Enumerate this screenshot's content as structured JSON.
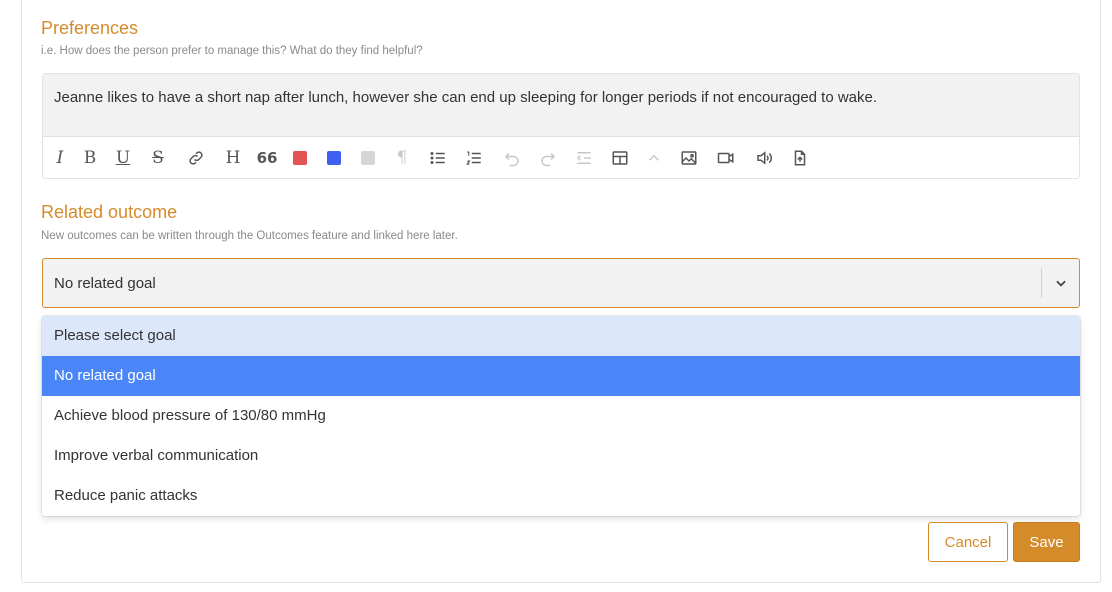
{
  "preferences": {
    "title": "Preferences",
    "hint": "i.e. How does the person prefer to manage this? What do they find helpful?",
    "editor_text": "Jeanne likes to have a short nap after lunch, however she can end up sleeping for longer periods if not encouraged to wake.",
    "toolbar": {
      "icons": [
        "italic-icon",
        "bold-icon",
        "underline-icon",
        "strikethrough-icon",
        "link-icon",
        "heading-icon",
        "quote-icon",
        "color-red-icon",
        "color-blue-icon",
        "color-gray-icon",
        "paragraph-icon",
        "bullet-list-icon",
        "numbered-list-icon",
        "undo-icon",
        "redo-icon",
        "outdent-icon",
        "table-icon",
        "collapse-icon",
        "image-icon",
        "video-icon",
        "audio-icon",
        "file-upload-icon"
      ],
      "colors": {
        "red": "#e35354",
        "blue": "#3f5ff0",
        "gray": "#d6d6d6"
      }
    }
  },
  "related_outcome": {
    "title": "Related outcome",
    "hint": "New outcomes can be written through the Outcomes feature and linked here later.",
    "selected_value": "No related goal",
    "options": [
      "Please select goal",
      "No related goal",
      "Achieve blood pressure of 130/80 mmHg",
      "Improve verbal communication",
      "Reduce panic attacks"
    ]
  },
  "actions": {
    "cancel_label": "Cancel",
    "save_label": "Save"
  },
  "colors": {
    "accent": "#d58b2a",
    "selected_option": "#4a86f7",
    "hover_option": "#dde7fc"
  }
}
